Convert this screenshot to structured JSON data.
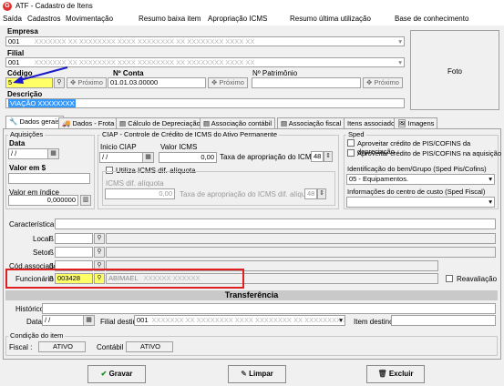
{
  "window": {
    "title": "ATF - Cadastro de Itens",
    "logo": "G"
  },
  "menu": [
    "Saída",
    "Cadastros",
    "Movimentação",
    "Resumo baixa item",
    "Apropriação ICMS",
    "Resumo última utilização",
    "Base de conhecimento"
  ],
  "header": {
    "empresa_label": "Empresa",
    "empresa_value": "001",
    "empresa_name": "XXXXXXX XX XXXXXXXX XXXX XXXXXXXX XX XXXXXXXX XXXX XX",
    "filial_label": "Filial",
    "filial_value": "001",
    "filial_name": "XXXXXXX XX XXXXXXXX XXXX XXXXXXXX XX XXXXXXXX XXXX XX",
    "codigo_label": "Código",
    "codigo_value": "5",
    "proximo_label": "Próximo",
    "nconta_label": "Nº Conta",
    "nconta_value": "01.01.03.00000",
    "npatrimonio_label": "Nº Patrimônio",
    "npatrimonio_value": "",
    "descricao_label": "Descrição",
    "descricao_value": "VIAÇÃO XXXXXXXX",
    "foto_label": "Foto"
  },
  "tabs": [
    "Dados gerais",
    "Dados - Frota",
    "Cálculo de Depreciação",
    "Associação contábil",
    "Associação fiscal",
    "Itens associados",
    "Imagens"
  ],
  "aquisicoes": {
    "title": "Aquisições",
    "data_label": "Data",
    "data_value": "/ /",
    "valor_label": "Valor em $",
    "valor_value": "",
    "valor_indice_label": "Valor em índice",
    "valor_indice_value": "0,000000"
  },
  "ciap": {
    "title": "CIAP - Controle de Crédito de ICMS do Ativo Permanente",
    "inicio_label": "Inicio CIAP",
    "inicio_value": "/ /",
    "valor_icms_label": "Valor ICMS",
    "valor_icms_value": "0,00",
    "taxa_label": "Taxa de apropriação do ICMS 1/",
    "taxa_value": "48",
    "utiliza_label": "Utiliza ICMS dif. alíquota",
    "icms_dif_label": "ICMS dif. alíquota",
    "icms_dif_value": "0,00",
    "taxa_dif_label": "Taxa de apropriação do ICMS dif. alíquota 1/",
    "taxa_dif_value": "48"
  },
  "sped": {
    "title": "Sped",
    "chk1_label": "Aproveitar crédito de PIS/COFINS da depreciação",
    "chk2_label": "Aproveitar crédito de PIS/COFINS na aquisição",
    "ident_label": "Identificação do bem/Grupo (Sped Pis/Cofins)",
    "ident_value": "05 - Equipamentos.",
    "centro_label": "Informações do centro de custo (Sped Fiscal)",
    "centro_value": ""
  },
  "detalhes": {
    "caracteristica_label": "Característica",
    "local_label": "Local",
    "setor_label": "Setor",
    "cod_associado_label": "Cód.associado",
    "funcionario_label": "Funcionário",
    "funcionario_value": "003428",
    "funcionario_name": "ABIMAEL",
    "funcionario_surname": "XXXXXX XXXXXX",
    "reavaliacao_label": "Reavaliação"
  },
  "transferencia": {
    "title": "Transferência",
    "historico_label": "Histórico",
    "data_label": "Data",
    "data_value": "/ /",
    "filial_destino_label": "Filial destino",
    "filial_destino_value": "001",
    "filial_destino_name": "XXXXXXX XX XXXXXXXX XXXX XXXXXXXX XX XXXXXXXX XXXX",
    "item_destino_label": "Item destino"
  },
  "condicao": {
    "title": "Condição do item",
    "fiscal_label": "Fiscal :",
    "fiscal_value": "ATIVO",
    "contabil_label": "Contábil :",
    "contabil_value": "ATIVO"
  },
  "buttons": {
    "gravar": "Gravar",
    "limpar": "Limpar",
    "excluir": "Excluir"
  },
  "colors": {
    "highlight_yellow": "#ffff66",
    "annotation_red": "#e02020",
    "arrow_blue": "#1a1acc",
    "selection_blue": "#3399ff"
  }
}
